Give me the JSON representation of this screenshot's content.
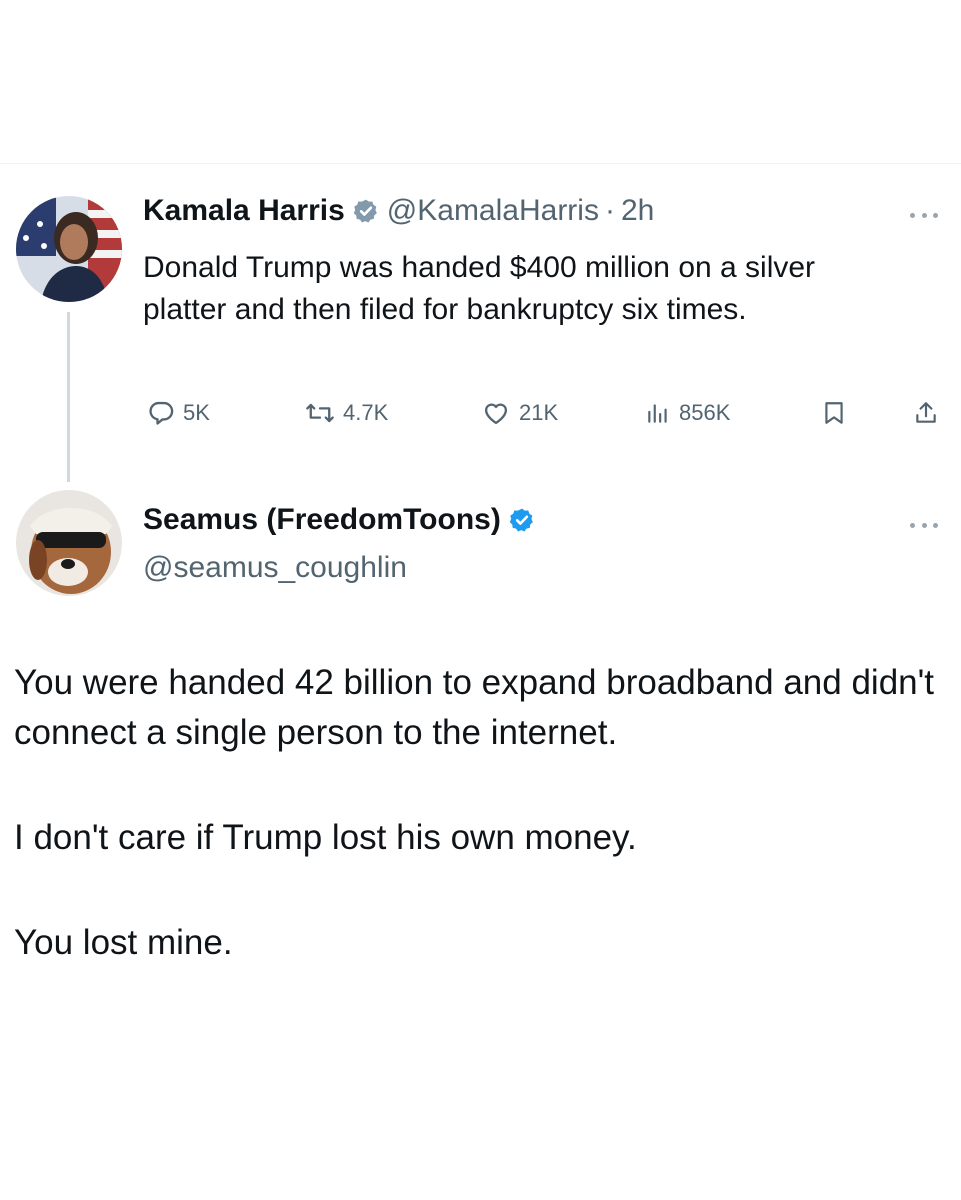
{
  "tweet": {
    "author_name": "Kamala Harris",
    "author_handle": "@KamalaHarris",
    "separator": "·",
    "time": "2h",
    "text": "Donald Trump was handed $400 million on a silver platter and then filed for bankruptcy six times.",
    "verified_badge": "gray-verified-badge-icon",
    "stats": {
      "replies": "5K",
      "reposts": "4.7K",
      "likes": "21K",
      "views": "856K"
    }
  },
  "reply": {
    "author_name": "Seamus (FreedomToons)",
    "author_handle": "@seamus_coughlin",
    "verified_badge": "blue-verified-badge-icon",
    "paragraphs": [
      "You were handed 42 billion to expand broadband and didn't connect a single person to the internet.",
      "I don't care if Trump lost his own money.",
      "You lost mine."
    ]
  },
  "colors": {
    "text": "#0f1419",
    "secondary": "#536471",
    "gray_badge": "#829aab",
    "blue_badge": "#1d9bf0",
    "thread_line": "#cfd9de"
  }
}
